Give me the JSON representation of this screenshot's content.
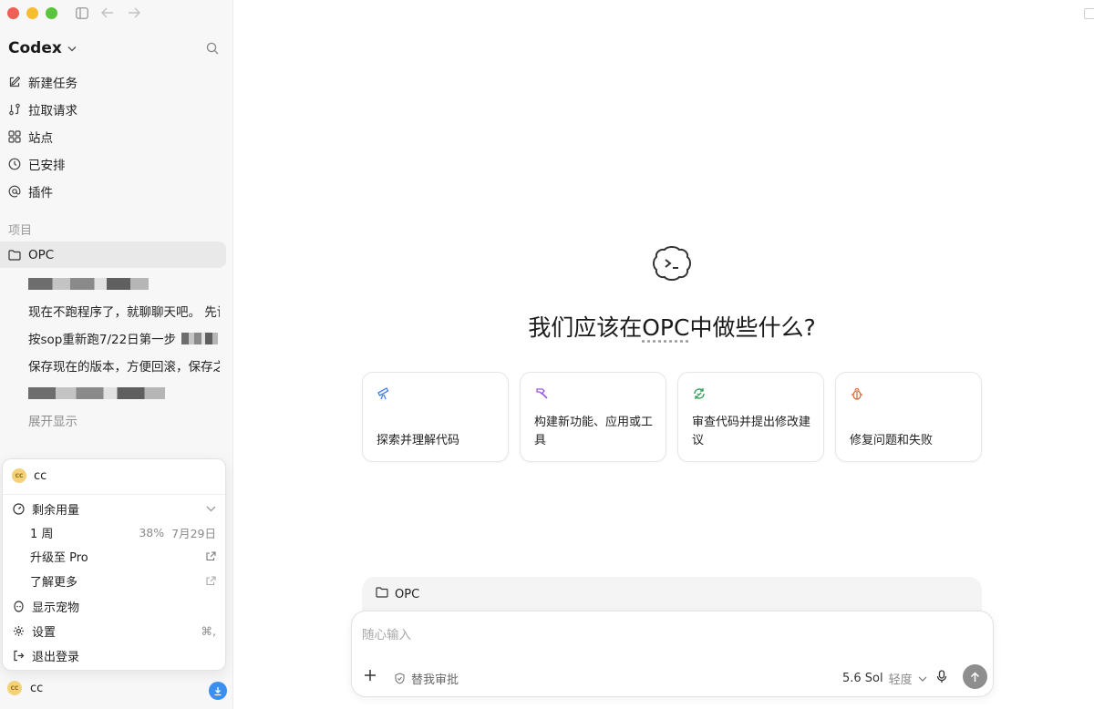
{
  "sidebar": {
    "brand": "Codex",
    "nav": [
      {
        "label": "新建任务",
        "icon": "edit-icon"
      },
      {
        "label": "拉取请求",
        "icon": "pull-request-icon"
      },
      {
        "label": "站点",
        "icon": "grid-icon"
      },
      {
        "label": "已安排",
        "icon": "clock-icon"
      },
      {
        "label": "插件",
        "icon": "at-icon"
      }
    ],
    "section_label": "项目",
    "project": "OPC",
    "threads": [
      "现在不跑程序了，就聊聊天吧。 先试",
      "按sop重新跑7/22日第一步",
      "保存现在的版本，方便回滚，保存之"
    ],
    "expand_label": "展开显示"
  },
  "account_menu": {
    "user_initials": "CC",
    "username": "cc",
    "usage_label": "剩余用量",
    "period_label": "1 周",
    "usage_percent": "38%",
    "reset_date": "7月29日",
    "upgrade_label": "升级至 Pro",
    "learn_more_label": "了解更多",
    "pet_label": "显示宠物",
    "settings_label": "设置",
    "settings_shortcut": "⌘,",
    "logout_label": "退出登录"
  },
  "footer": {
    "initials": "CC",
    "username": "cc"
  },
  "main": {
    "title_before": "我们应该在",
    "title_project": "OPC",
    "title_after": "中做些什么?",
    "cards": [
      {
        "label": "探索并理解代码",
        "icon": "telescope-icon",
        "color": "#4a7fe0"
      },
      {
        "label": "构建新功能、应用或工具",
        "icon": "hammer-icon",
        "color": "#9b59d6"
      },
      {
        "label": "审查代码并提出修改建议",
        "icon": "review-icon",
        "color": "#2e9e55"
      },
      {
        "label": "修复问题和失败",
        "icon": "bug-icon",
        "color": "#d9663a"
      }
    ]
  },
  "composer": {
    "project": "OPC",
    "placeholder": "随心输入",
    "approval_label": "替我审批",
    "model": "5.6 Sol",
    "effort": "轻度"
  }
}
